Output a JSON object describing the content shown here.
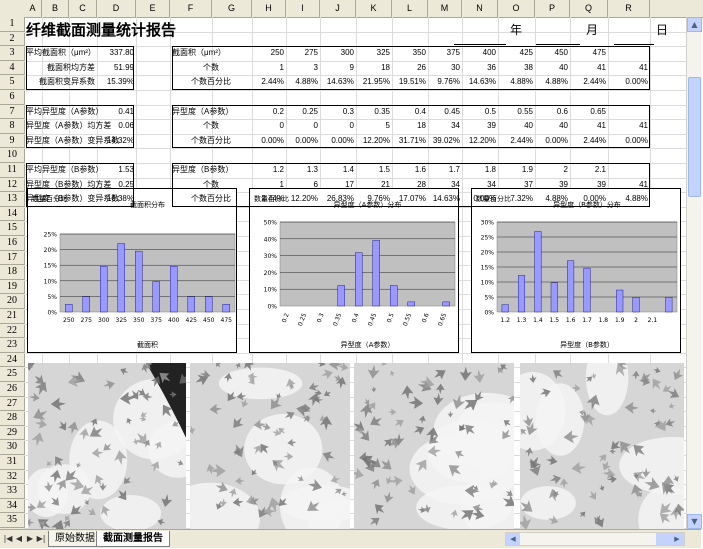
{
  "columns": [
    "A",
    "B",
    "C",
    "D",
    "E",
    "F",
    "G",
    "H",
    "I",
    "J",
    "K",
    "L",
    "M",
    "N",
    "O",
    "P",
    "Q",
    "R"
  ],
  "rows": [
    "1",
    "2",
    "3",
    "4",
    "5",
    "6",
    "7",
    "8",
    "9",
    "10",
    "11",
    "12",
    "13",
    "14",
    "15",
    "16",
    "17",
    "18",
    "19",
    "20",
    "21",
    "22",
    "23",
    "24",
    "25",
    "26",
    "27",
    "28",
    "29",
    "30",
    "31",
    "32",
    "33",
    "34",
    "35"
  ],
  "title": "纤维截面测量统计报告",
  "date_labels": {
    "year": "年",
    "month": "月",
    "day": "日"
  },
  "area_summary": {
    "labels": [
      "平均截面积（μm²）",
      "截面积均方差",
      "截面积变异系数"
    ],
    "values": [
      "337.80",
      "51.99",
      "15.39%"
    ]
  },
  "a_summary": {
    "labels": [
      "平均异型度（A参数）",
      "异型度（A参数）均方差",
      "异型度（A参数）变异系数"
    ],
    "values": [
      "0.41",
      "0.06",
      "14.32%"
    ]
  },
  "b_summary": {
    "labels": [
      "平均异型度（B参数）",
      "异型度（B参数）均方差",
      "异型度（B参数）变异系数"
    ],
    "values": [
      "1.53",
      "0.25",
      "16.38%"
    ]
  },
  "area_table": {
    "row_labels": [
      "截面积（μm²）",
      "个数",
      "个数百分比"
    ],
    "rows": [
      [
        "250",
        "275",
        "300",
        "325",
        "350",
        "375",
        "400",
        "425",
        "450",
        "475",
        ""
      ],
      [
        "1",
        "3",
        "9",
        "18",
        "26",
        "30",
        "36",
        "38",
        "40",
        "41",
        "41"
      ],
      [
        "2.44%",
        "4.88%",
        "14.63%",
        "21.95%",
        "19.51%",
        "9.76%",
        "14.63%",
        "4.88%",
        "4.88%",
        "2.44%",
        "0.00%"
      ]
    ]
  },
  "a_table": {
    "row_labels": [
      "异型度（A参数）",
      "个数",
      "个数百分比"
    ],
    "rows": [
      [
        "0.2",
        "0.25",
        "0.3",
        "0.35",
        "0.4",
        "0.45",
        "0.5",
        "0.55",
        "0.6",
        "0.65",
        ""
      ],
      [
        "0",
        "0",
        "0",
        "5",
        "18",
        "34",
        "39",
        "40",
        "40",
        "41",
        "41"
      ],
      [
        "0.00%",
        "0.00%",
        "0.00%",
        "12.20%",
        "31.71%",
        "39.02%",
        "12.20%",
        "2.44%",
        "0.00%",
        "2.44%",
        "0.00%"
      ]
    ]
  },
  "b_table": {
    "row_labels": [
      "异型度（B参数）",
      "个数",
      "个数百分比"
    ],
    "rows": [
      [
        "1.2",
        "1.3",
        "1.4",
        "1.5",
        "1.6",
        "1.7",
        "1.8",
        "1.9",
        "2",
        "2.1",
        ""
      ],
      [
        "1",
        "6",
        "17",
        "21",
        "28",
        "34",
        "34",
        "37",
        "39",
        "39",
        "41"
      ],
      [
        "2.44%",
        "12.20%",
        "26.83%",
        "9.76%",
        "17.07%",
        "14.63%",
        "0.00%",
        "7.32%",
        "4.88%",
        "0.00%",
        "4.88%"
      ]
    ]
  },
  "chart_data": [
    {
      "type": "bar",
      "title": "截面积分布",
      "ylabel": "数量百分比",
      "xlabel": "截面积",
      "categories": [
        "250",
        "275",
        "300",
        "325",
        "350",
        "375",
        "400",
        "425",
        "450",
        "475"
      ],
      "values": [
        2.44,
        4.88,
        14.63,
        21.95,
        19.51,
        9.76,
        14.63,
        4.88,
        4.88,
        2.44
      ],
      "ylim": [
        0,
        25
      ],
      "yticks": [
        "0%",
        "5%",
        "10%",
        "15%",
        "20%",
        "25%"
      ],
      "grid": true,
      "color": "#9999ff"
    },
    {
      "type": "bar",
      "title": "异型度（A参数）分布",
      "ylabel": "数量百分比",
      "xlabel": "异型度（A参数）",
      "categories": [
        "0.2",
        "0.25",
        "0.3",
        "0.35",
        "0.4",
        "0.45",
        "0.5",
        "0.55",
        "0.6",
        "0.65"
      ],
      "values": [
        0,
        0,
        0,
        12.2,
        31.71,
        39.02,
        12.2,
        2.44,
        0,
        2.44
      ],
      "ylim": [
        0,
        50
      ],
      "yticks": [
        "0%",
        "10%",
        "20%",
        "30%",
        "40%",
        "50%"
      ],
      "grid": true,
      "color": "#9999ff"
    },
    {
      "type": "bar",
      "title": "异型度（B参数）分布",
      "ylabel": "数量百分比",
      "xlabel": "异型度（B参数）",
      "categories": [
        "1.2",
        "1.3",
        "1.4",
        "1.5",
        "1.6",
        "1.7",
        "1.8",
        "1.9",
        "2",
        "2.1"
      ],
      "values": [
        2.44,
        12.2,
        26.83,
        9.76,
        17.07,
        14.63,
        0,
        7.32,
        4.88,
        0,
        4.88
      ],
      "ylim": [
        0,
        30
      ],
      "yticks": [
        "0%",
        "5%",
        "10%",
        "15%",
        "20%",
        "25%",
        "30%"
      ],
      "grid": true,
      "color": "#9999ff"
    }
  ],
  "tabs": [
    "原始数据",
    "截面测量报告"
  ],
  "active_tab": "截面测量报告",
  "colors": {
    "chart_bg": "#c0c0c0",
    "bar": "#9999ff",
    "header_bg": "#ece9d8"
  }
}
